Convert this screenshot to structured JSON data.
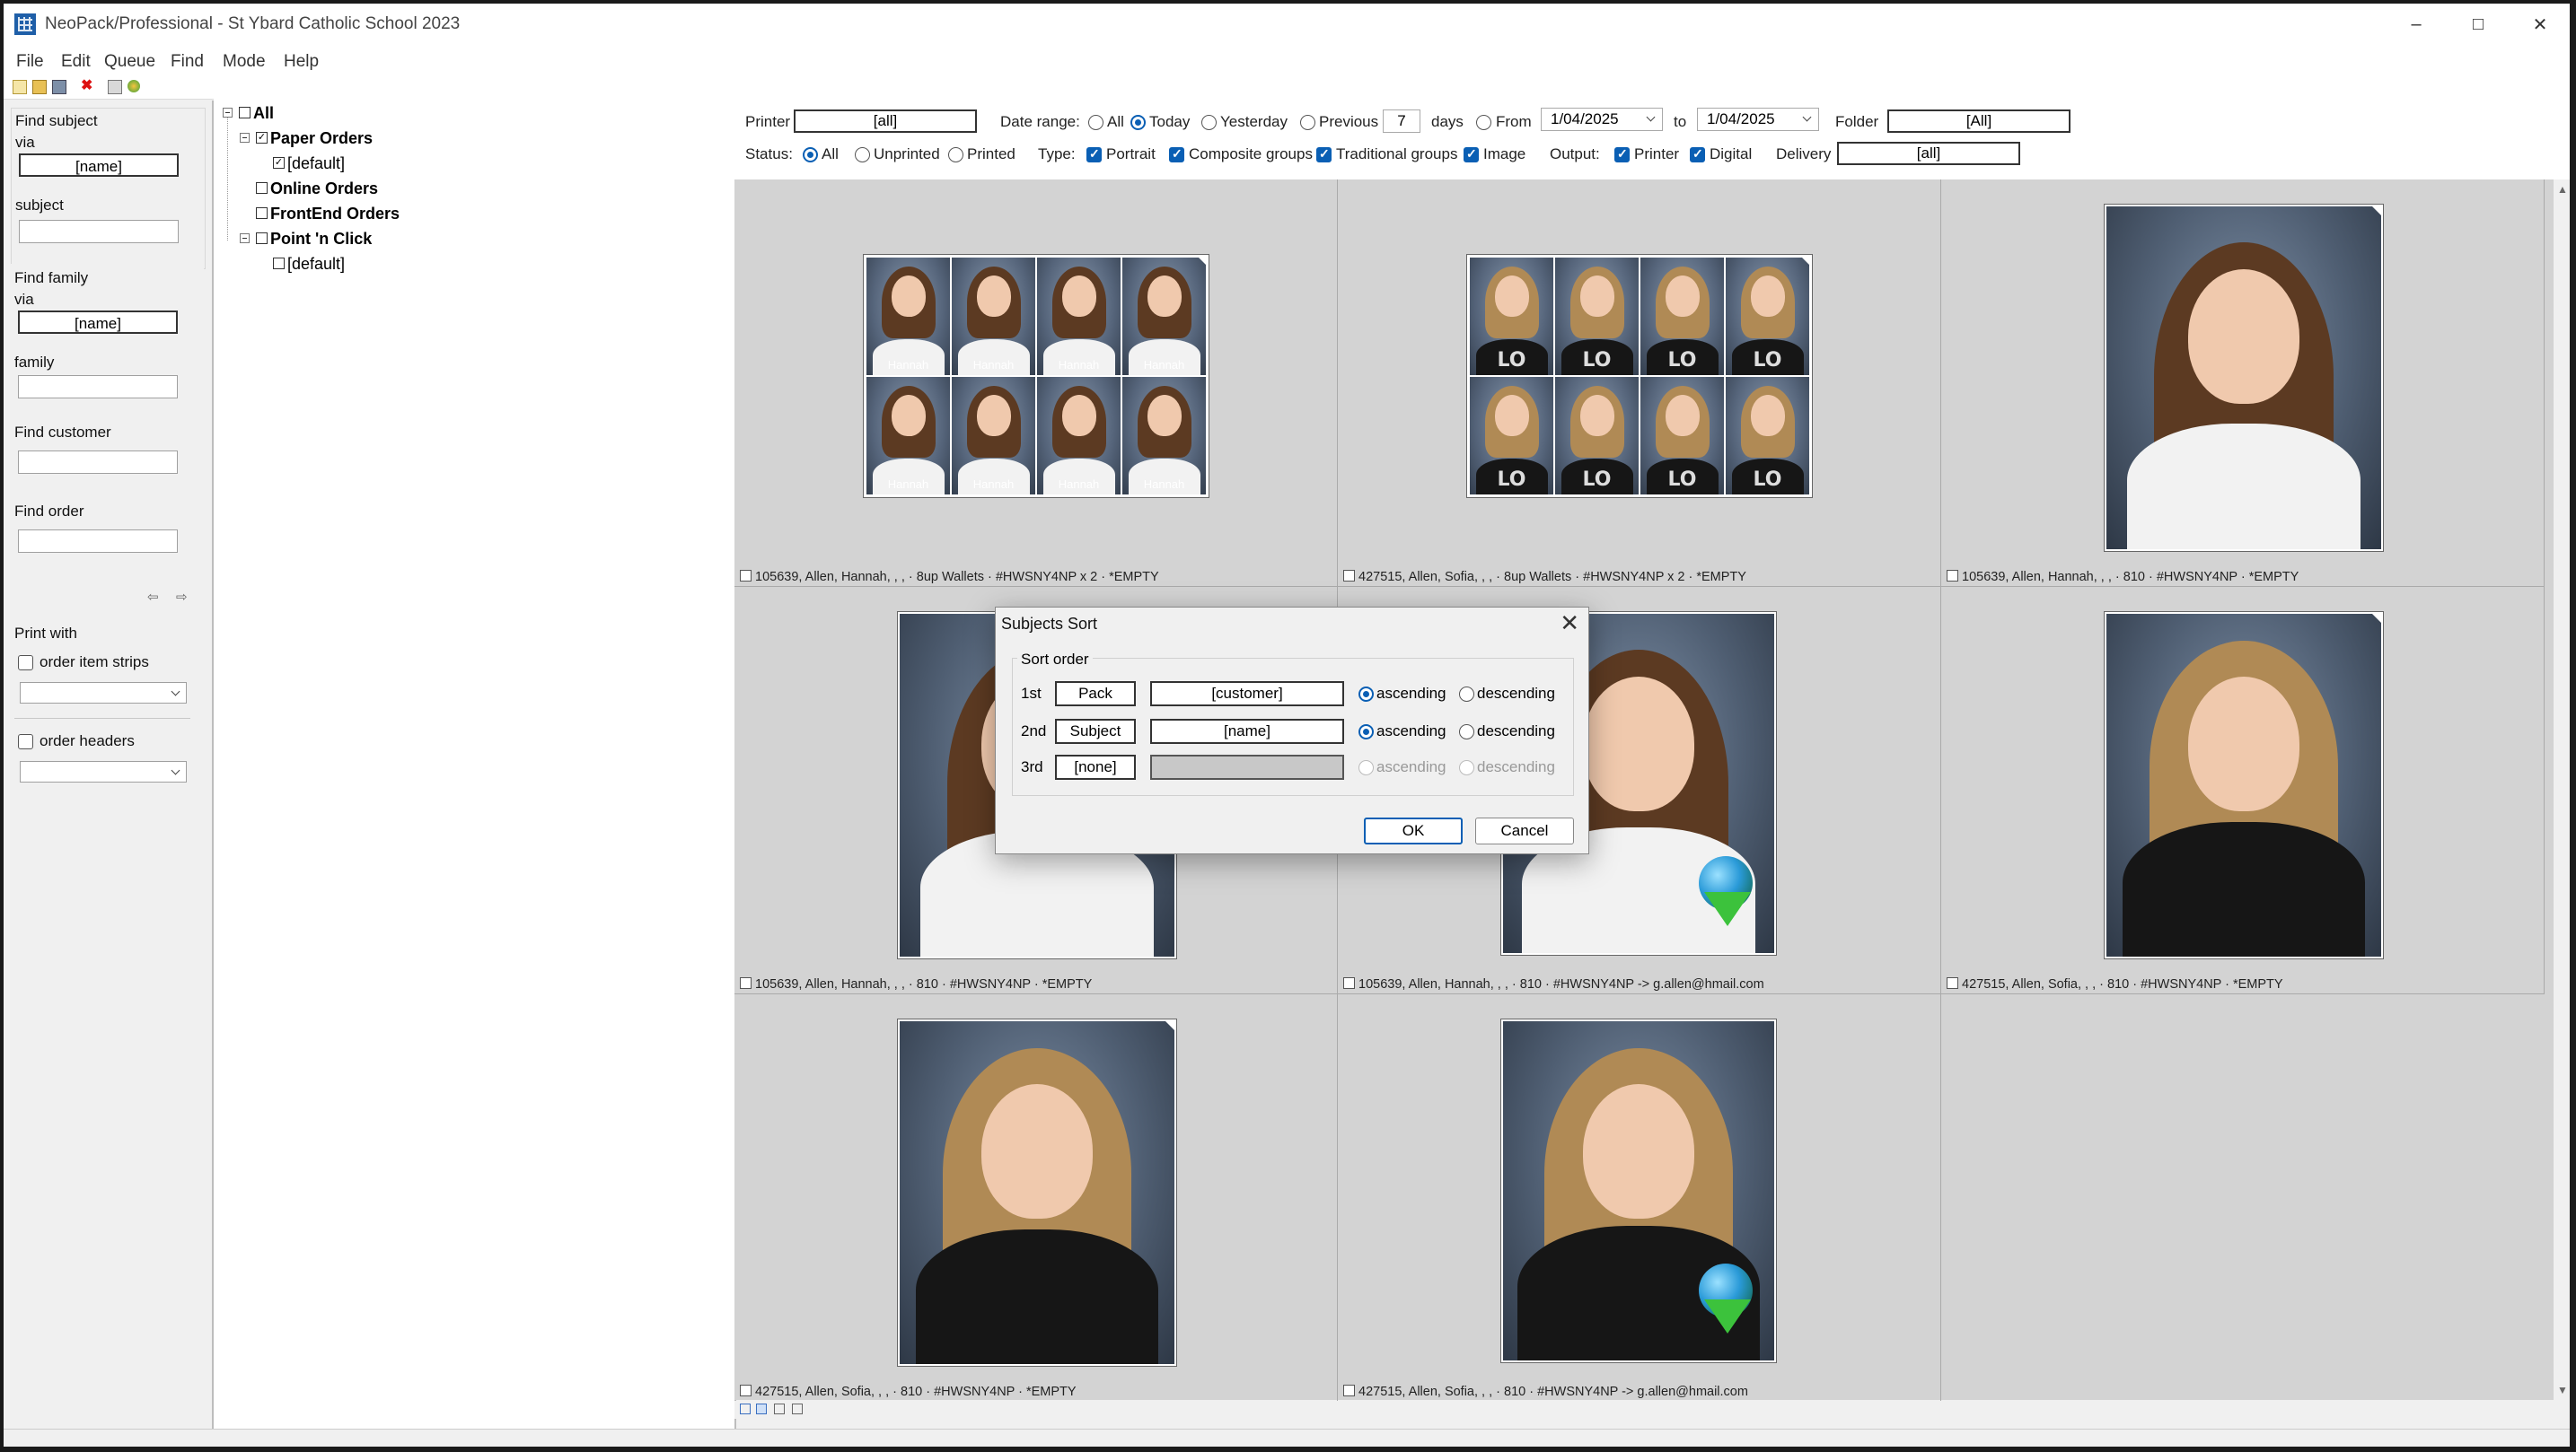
{
  "window": {
    "title": "NeoPack/Professional - St Ybard Catholic School 2023"
  },
  "menu": [
    "File",
    "Edit",
    "Queue",
    "Find",
    "Mode",
    "Help"
  ],
  "toolbar_icons": [
    "new-icon",
    "open-icon",
    "save-icon",
    "delete-icon",
    "print-icon",
    "refresh-icon"
  ],
  "left": {
    "find_subject": {
      "title": "Find subject",
      "via_label": "via",
      "via_value": "[name]",
      "subject_label": "subject",
      "subject_value": ""
    },
    "find_family": {
      "title": "Find family",
      "via_label": "via",
      "via_value": "[name]",
      "family_label": "family",
      "family_value": ""
    },
    "find_customer": {
      "title": "Find customer",
      "value": ""
    },
    "find_order": {
      "title": "Find order",
      "value": ""
    },
    "print_with": {
      "title": "Print with",
      "strips_label": "order item strips",
      "headers_label": "order headers"
    }
  },
  "tree": {
    "root": "All",
    "nodes": [
      {
        "label": "Paper Orders",
        "checked": true
      },
      {
        "label": "[default]",
        "checked": true
      },
      {
        "label": "Online Orders",
        "checked": false
      },
      {
        "label": "FrontEnd Orders",
        "checked": false
      },
      {
        "label": "Point 'n Click",
        "checked": false
      },
      {
        "label": "[default]",
        "checked": false
      }
    ]
  },
  "filters": {
    "printer_label": "Printer",
    "printer_value": "[all]",
    "date_label": "Date range:",
    "date_all": "All",
    "date_today": "Today",
    "date_yesterday": "Yesterday",
    "date_previous": "Previous",
    "previous_days": "7",
    "days_label": "days",
    "date_from": "From",
    "from_date": "1/04/2025",
    "to_label": "to",
    "to_date": "1/04/2025",
    "folder_label": "Folder",
    "folder_value": "[All]",
    "status_label": "Status:",
    "status_all": "All",
    "status_unprinted": "Unprinted",
    "status_printed": "Printed",
    "type_label": "Type:",
    "type_portrait": "Portrait",
    "type_composite": "Composite groups",
    "type_traditional": "Traditional groups",
    "type_image": "Image",
    "output_label": "Output:",
    "output_printer": "Printer",
    "output_digital": "Digital",
    "delivery_label": "Delivery",
    "delivery_value": "[all]"
  },
  "thumbnails": [
    {
      "caption": "105639, Allen, Hannah, , , · 8up Wallets · #HWSNY4NP x 2 · *EMPTY",
      "kind": "wallets",
      "name": "Hannah"
    },
    {
      "caption": "427515, Allen, Sofia, , , · 8up Wallets · #HWSNY4NP x 2 · *EMPTY",
      "kind": "wallets-lo"
    },
    {
      "caption": "105639, Allen, Hannah, , , · 810 · #HWSNY4NP · *EMPTY",
      "kind": "portrait-h"
    },
    {
      "caption": "105639, Allen, Hannah, , , · 810 · #HWSNY4NP · *EMPTY",
      "kind": "portrait-h"
    },
    {
      "caption": "105639, Allen, Hannah, , , · 810 · #HWSNY4NP -> g.allen@hmail.com",
      "kind": "portrait-h-digital"
    },
    {
      "caption": "427515, Allen, Sofia, , , · 810 · #HWSNY4NP · *EMPTY",
      "kind": "portrait-s"
    },
    {
      "caption": "427515, Allen, Sofia, , , · 810 · #HWSNY4NP · *EMPTY",
      "kind": "portrait-s"
    },
    {
      "caption": "427515, Allen, Sofia, , , · 810 · #HWSNY4NP -> g.allen@hmail.com",
      "kind": "portrait-s-digital"
    }
  ],
  "dialog": {
    "title": "Subjects Sort",
    "group_label": "Sort order",
    "rows": [
      {
        "ordinal": "1st",
        "key": "Pack",
        "field": "[customer]",
        "asc": "ascending",
        "desc": "descending"
      },
      {
        "ordinal": "2nd",
        "key": "Subject",
        "field": "[name]",
        "asc": "ascending",
        "desc": "descending"
      },
      {
        "ordinal": "3rd",
        "key": "[none]",
        "field": "",
        "asc": "ascending",
        "desc": "descending"
      }
    ],
    "ok": "OK",
    "cancel": "Cancel"
  }
}
